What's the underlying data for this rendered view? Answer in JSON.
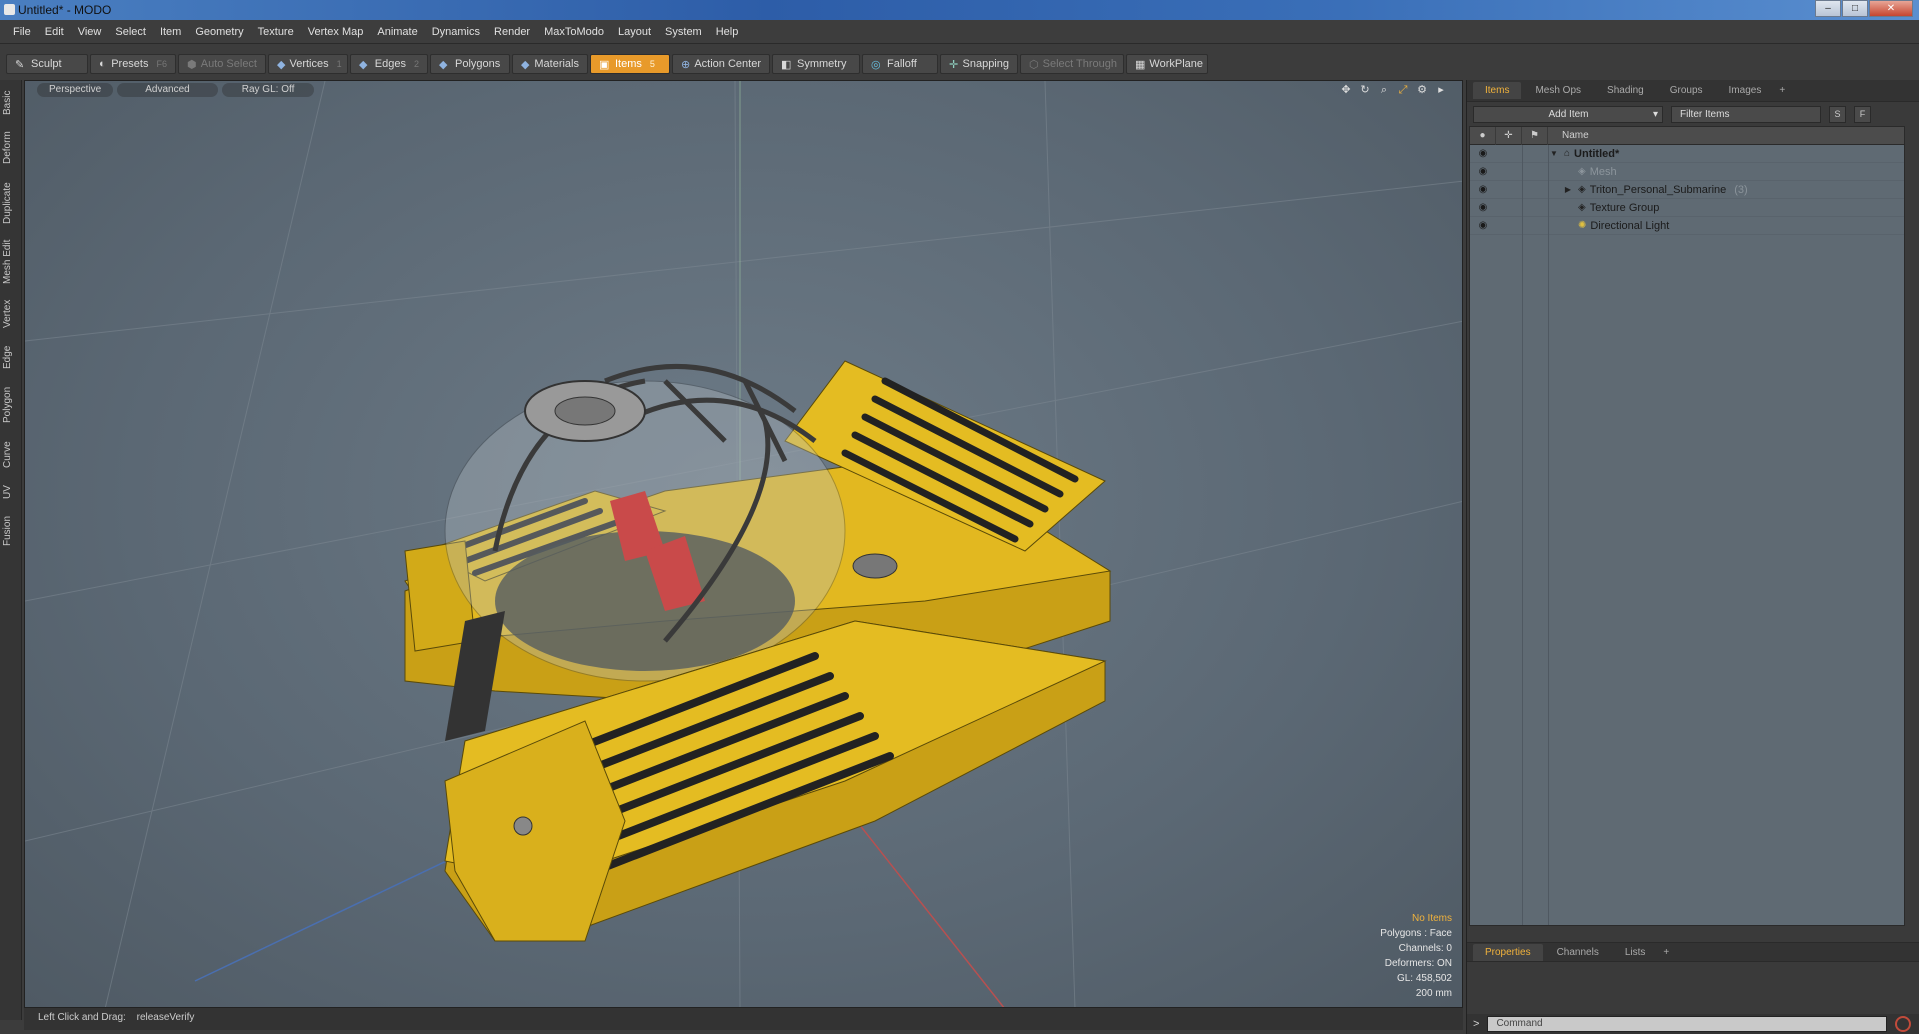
{
  "window": {
    "title": "Untitled* - MODO",
    "min": "–",
    "max": "□",
    "close": "✕"
  },
  "menu": [
    "File",
    "Edit",
    "View",
    "Select",
    "Item",
    "Geometry",
    "Texture",
    "Vertex Map",
    "Animate",
    "Dynamics",
    "Render",
    "MaxToModo",
    "Layout",
    "System",
    "Help"
  ],
  "toolbar": {
    "sculpt": "Sculpt",
    "presets": "Presets",
    "presets_key": "F6",
    "auto_select": "Auto Select",
    "vertices": "Vertices",
    "vertices_key": "1",
    "edges": "Edges",
    "edges_key": "2",
    "polygons": "Polygons",
    "materials": "Materials",
    "items": "Items",
    "items_key": "5",
    "action_center": "Action Center",
    "symmetry": "Symmetry",
    "falloff": "Falloff",
    "snapping": "Snapping",
    "select_through": "Select Through",
    "workplane": "WorkPlane"
  },
  "left_tabs": [
    "Basic",
    "Deform",
    "Duplicate",
    "Mesh Edit",
    "Vertex",
    "Edge",
    "Polygon",
    "Curve",
    "UV",
    "Fusion"
  ],
  "viewport": {
    "view": "Perspective",
    "shading": "Advanced",
    "raygl": "Ray GL: Off",
    "info": {
      "selection": "No Items",
      "polygons": "Polygons : Face",
      "channels": "Channels: 0",
      "deformers": "Deformers: ON",
      "gl": "GL: 458,502",
      "scale": "200 mm"
    }
  },
  "status": {
    "label": "Left Click and Drag:",
    "value": "releaseVerify"
  },
  "panel": {
    "tabs": [
      "Items",
      "Mesh Ops",
      "Shading",
      "Groups",
      "Images"
    ],
    "add_item": "Add Item",
    "filter": "Filter Items",
    "btn_s": "S",
    "btn_f": "F",
    "col_name": "Name",
    "tree": [
      {
        "label": "Untitled*",
        "type": "root"
      },
      {
        "label": "Mesh",
        "type": "mesh"
      },
      {
        "label": "Triton_Personal_Submarine",
        "count": "(3)",
        "type": "group"
      },
      {
        "label": "Texture Group",
        "type": "texture"
      },
      {
        "label": "Directional Light",
        "type": "light"
      }
    ],
    "bottom_tabs": [
      "Properties",
      "Channels",
      "Lists"
    ],
    "command_placeholder": "Command"
  },
  "colors": {
    "accent": "#f0b23c",
    "hull": "#e0b020",
    "viewport_bg": "#5f6b76"
  }
}
